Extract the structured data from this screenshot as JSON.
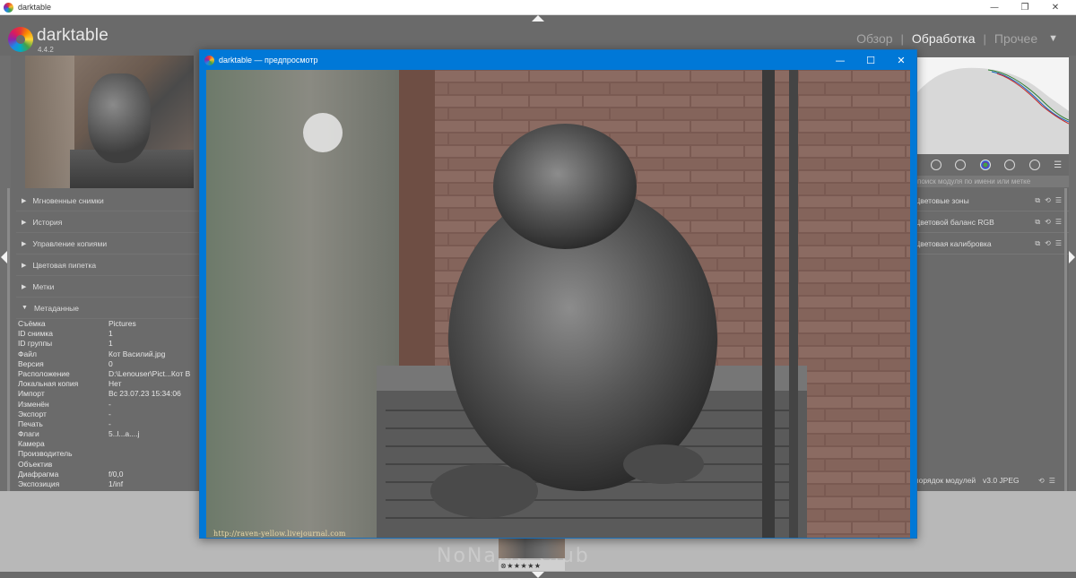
{
  "os_window": {
    "title": "darktable",
    "controls": {
      "minimize": "—",
      "maximize": "❐",
      "close": "✕"
    }
  },
  "app": {
    "name": "darktable",
    "version": "4.4.2",
    "views": [
      {
        "label": "Обзор",
        "active": false
      },
      {
        "label": "Обработка",
        "active": true
      },
      {
        "label": "Прочее",
        "active": false
      }
    ],
    "view_separator": "|",
    "views_dropdown": "▼"
  },
  "left_panel": {
    "modules": [
      {
        "label": "Мгновенные снимки",
        "expanded": false
      },
      {
        "label": "История",
        "expanded": false
      },
      {
        "label": "Управление копиями",
        "expanded": false
      },
      {
        "label": "Цветовая пипетка",
        "expanded": false
      },
      {
        "label": "Метки",
        "expanded": false
      },
      {
        "label": "Метаданные",
        "expanded": true
      }
    ],
    "metadata": [
      {
        "key": "Съёмка",
        "value": "Pictures"
      },
      {
        "key": "ID снимка",
        "value": "1"
      },
      {
        "key": "ID группы",
        "value": "1"
      },
      {
        "key": "Файл",
        "value": "Кот Василий.jpg"
      },
      {
        "key": "Версия",
        "value": "0"
      },
      {
        "key": "Расположение",
        "value": "D:\\Lenouser\\Pict...Кот В"
      },
      {
        "key": "Локальная копия",
        "value": "Нет"
      },
      {
        "key": "Импорт",
        "value": "Вс 23.07.23 15:34:06"
      },
      {
        "key": "Изменён",
        "value": "-"
      },
      {
        "key": "Экспорт",
        "value": "-"
      },
      {
        "key": "Печать",
        "value": "-"
      },
      {
        "key": "Флаги",
        "value": "5..l...a....j"
      },
      {
        "key": "Камера",
        "value": ""
      },
      {
        "key": "Производитель",
        "value": ""
      },
      {
        "key": "Объектив",
        "value": ""
      },
      {
        "key": "Диафрагма",
        "value": "f/0,0"
      },
      {
        "key": "Экспозиция",
        "value": "1/inf"
      }
    ]
  },
  "right_panel": {
    "search_placeholder": "поиск модуля по имени или метке",
    "tab_menu": "☰",
    "modules": [
      {
        "label": "Цветовые зоны"
      },
      {
        "label": "Цветовой баланс RGB"
      },
      {
        "label": "Цветовая калибровка"
      }
    ],
    "module_icons": {
      "multi": "⧉",
      "reset": "⟲",
      "presets": "☰"
    },
    "bottom": {
      "label": "порядок модулей",
      "style": "v3.0 JPEG"
    }
  },
  "preview_window": {
    "title": "darktable — предпросмотр",
    "controls": {
      "minimize": "—",
      "maximize": "☐",
      "close": "✕"
    },
    "caption": "http://raven-yellow.livejournal.com"
  },
  "filmstrip": {
    "rating": "★★★★★",
    "reject": "⊗",
    "watermark": "NoNaMe Club"
  },
  "colors": {
    "panel_bg": "#6b6b6b",
    "accent_blue": "#0078d7",
    "text_light": "#e6e6e6"
  }
}
